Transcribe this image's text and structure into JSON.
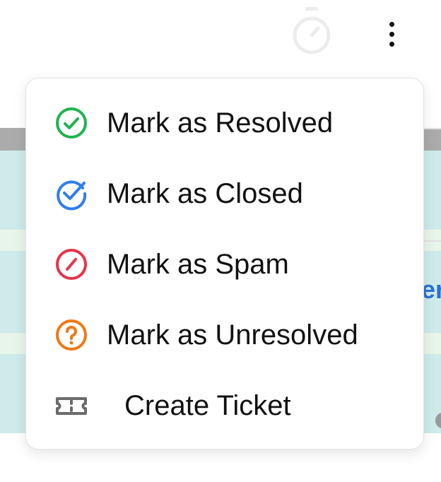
{
  "menu": {
    "items": [
      {
        "label": "Mark as Resolved",
        "icon": "check-circle-icon",
        "color": "#1fb34f"
      },
      {
        "label": "Mark as Closed",
        "icon": "check-badge-icon",
        "color": "#2f7df0"
      },
      {
        "label": "Mark as Spam",
        "icon": "block-icon",
        "color": "#e8324a"
      },
      {
        "label": "Mark as Unresolved",
        "icon": "question-circle-icon",
        "color": "#f07814"
      },
      {
        "label": "Create Ticket",
        "icon": "ticket-icon",
        "color": "#6b6b6b"
      }
    ]
  },
  "background": {
    "link_fragment": "er"
  }
}
